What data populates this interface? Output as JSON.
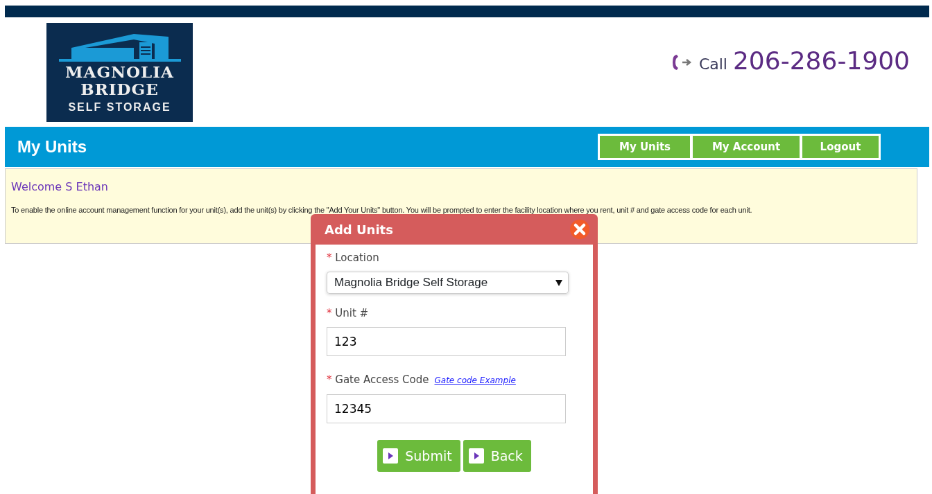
{
  "logo": {
    "line1": "MAGNOLIA",
    "line2": "BRIDGE",
    "line3": "SELF STORAGE"
  },
  "phone": {
    "label": "Call",
    "number": "206-286-1900"
  },
  "nav": {
    "title": "My Units",
    "buttons": [
      {
        "label": "My Units"
      },
      {
        "label": "My Account"
      },
      {
        "label": "Logout"
      }
    ]
  },
  "welcome": {
    "heading": "Welcome S Ethan",
    "message": "To enable the online account management function for your unit(s), add the unit(s) by clicking the \"Add Your Units\" button. You will be prompted to enter the facility location where you rent, unit # and gate access code for each unit."
  },
  "modal": {
    "title": "Add Units",
    "fields": [
      {
        "kind": "select",
        "required_mark": "*",
        "label": "Location",
        "value": "Magnolia Bridge Self Storage"
      },
      {
        "kind": "text",
        "required_mark": "*",
        "label": "Unit #",
        "value": "123"
      },
      {
        "kind": "text",
        "required_mark": "*",
        "label": "Gate Access Code",
        "value": "12345",
        "link": "Gate code Example"
      }
    ],
    "buttons": [
      {
        "label": "Submit"
      },
      {
        "label": "Back"
      }
    ]
  }
}
